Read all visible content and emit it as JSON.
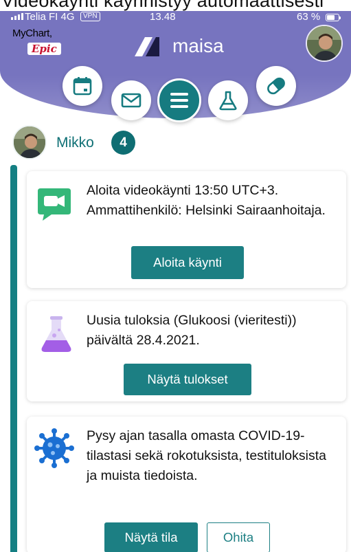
{
  "cut_text": "Videokäynti käynnistyy automaattisesti",
  "status_bar": {
    "carrier": "Telia FI  4G",
    "vpn": "VPN",
    "time": "13.48",
    "battery": "63 %"
  },
  "header": {
    "mychart_label": "MyChart,",
    "epic_label": "Epic",
    "app_name": "maisa"
  },
  "nav": {
    "items": [
      "calendar-icon",
      "mail-icon",
      "menu-icon",
      "flask-icon",
      "pill-icon"
    ]
  },
  "profile": {
    "name": "Mikko",
    "count": "4"
  },
  "cards": [
    {
      "icon": "video-chat-icon",
      "text": "Aloita videokäynti 13:50 UTC+3. Ammattihenkilö: Helsinki Sairaanhoitaja.",
      "primary_button": "Aloita käynti"
    },
    {
      "icon": "flask-icon",
      "text": "Uusia tuloksia (Glukoosi (vieritesti)) päivältä 28.4.2021.",
      "primary_button": "Näytä tulokset"
    },
    {
      "icon": "virus-icon",
      "text": "Pysy ajan tasalla omasta COVID-19-tilastasi sekä rokotuksista, testituloksista ja muista tiedoista.",
      "primary_button": "Näytä tila",
      "secondary_button": "Ohita"
    }
  ],
  "colors": {
    "header_purple": "#7774bf",
    "teal": "#1c7f83",
    "virus_blue": "#1b6fd2",
    "chat_green": "#34b779",
    "flask_purple": "#a35ee6"
  }
}
